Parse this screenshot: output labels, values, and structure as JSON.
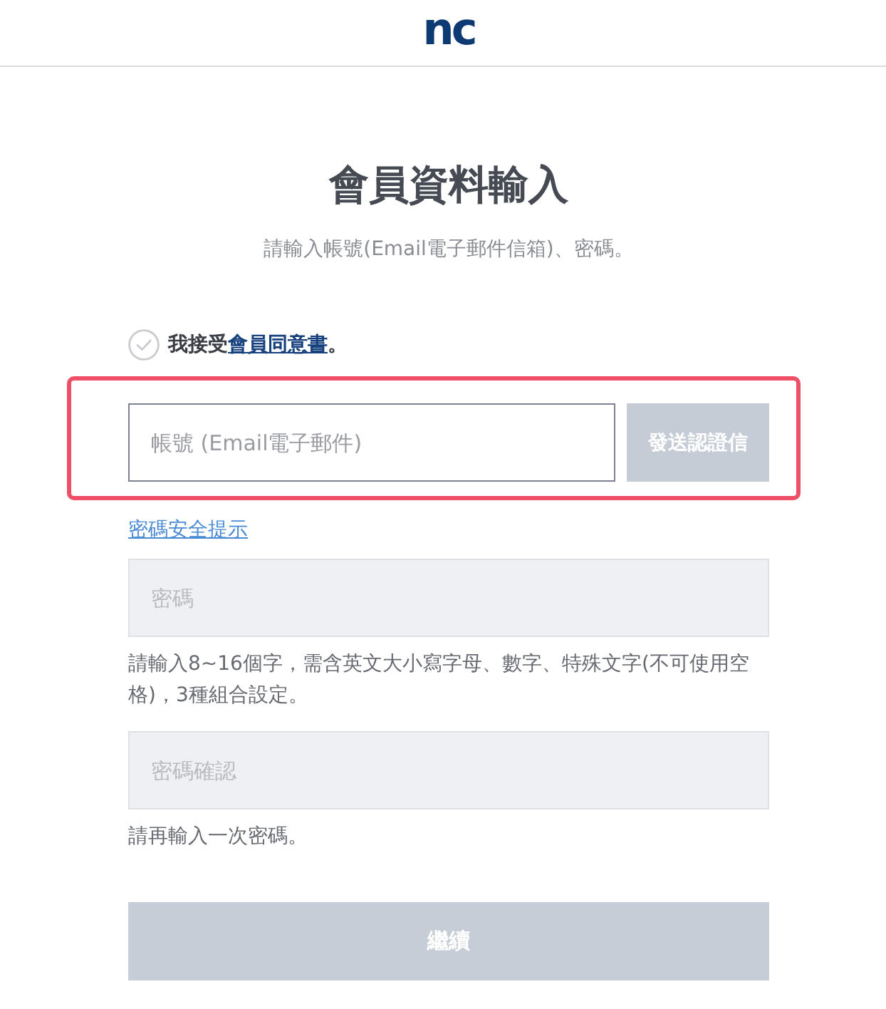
{
  "header": {
    "logo": "nc"
  },
  "title": "會員資料輸入",
  "subtitle": "請輸入帳號(Email電子郵件信箱)、密碼。",
  "consent": {
    "checked": false,
    "prefix": "我接受",
    "link": "會員同意書",
    "suffix": "。"
  },
  "account": {
    "highlighted": true,
    "field": {
      "placeholder": "帳號 (Email電子郵件)",
      "disabled": false
    },
    "send_button": {
      "label": "發送認證信",
      "disabled": true
    }
  },
  "password_tips_link": "密碼安全提示",
  "password": {
    "placeholder": "密碼",
    "disabled": true,
    "hint": "請輸入8~16個字，需含英文大小寫字母、數字、特殊文字(不可使用空格)，3種組合設定。"
  },
  "password_confirm": {
    "placeholder": "密碼確認",
    "disabled": true,
    "hint": "請再輸入一次密碼。"
  },
  "continue_button": {
    "label": "繼續",
    "disabled": true
  }
}
